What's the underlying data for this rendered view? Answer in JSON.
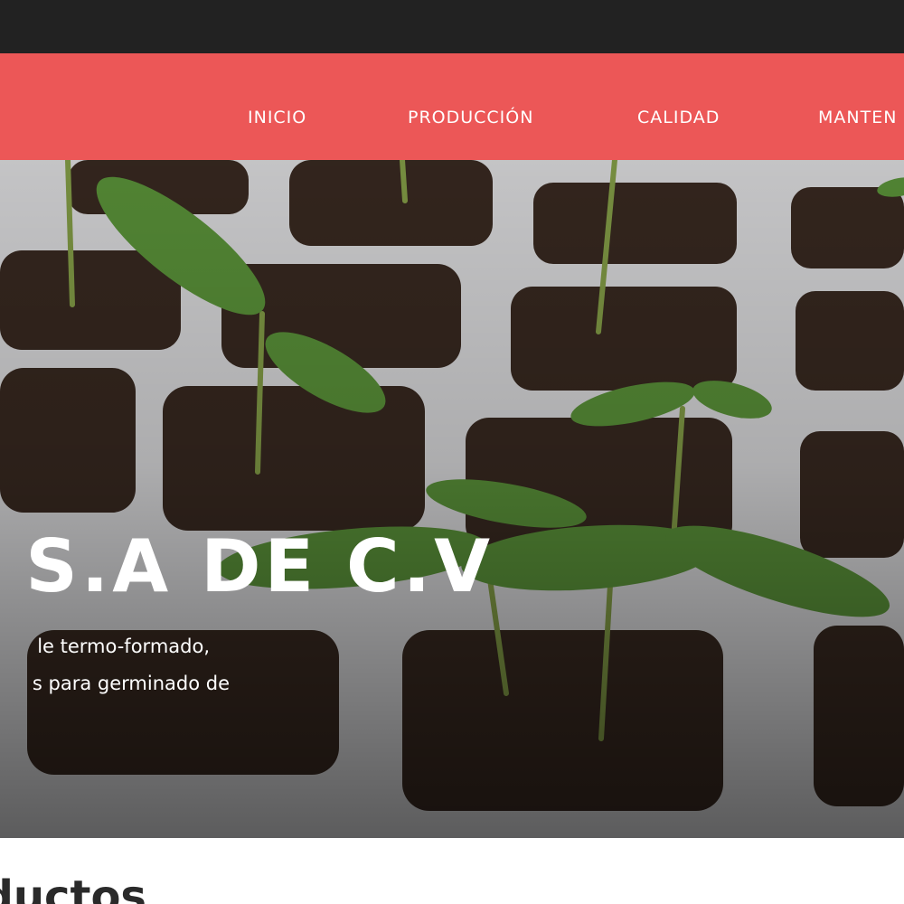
{
  "nav": {
    "items": [
      {
        "label": "INICIO"
      },
      {
        "label": "PRODUCCIÓN"
      },
      {
        "label": "CALIDAD"
      },
      {
        "label": "MANTEN"
      }
    ]
  },
  "hero": {
    "title": "S S.A DE C.V",
    "description_lines": [
      "le termo-formado,",
      "s para germinado de"
    ]
  },
  "section": {
    "heading": "ductos"
  },
  "colors": {
    "topbar": "#222222",
    "navbar": "#ec5757",
    "text_light": "#ffffff",
    "tray": "#e9e9ea",
    "soil": "#3a2a20",
    "leaf": "#5f9a3c"
  },
  "icons": {
    "hero_image": "seedling-tray-photo"
  }
}
